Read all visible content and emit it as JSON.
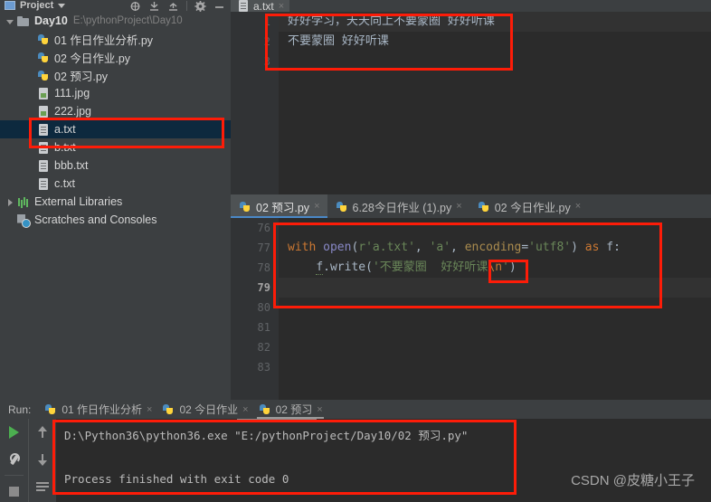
{
  "toolbar": {
    "project_label": "Project",
    "icons": [
      "locate-icon",
      "collapse-all-icon",
      "expand-all-icon",
      "settings-gear-icon",
      "minimize-icon"
    ]
  },
  "sidebar": {
    "items": [
      {
        "label": "Day10",
        "path": "E:\\pythonProject\\Day10",
        "icon": "folder-icon",
        "arrow": "down",
        "indent": 0,
        "bold": true,
        "selected": false
      },
      {
        "label": "01 作日作业分析.py",
        "path": "",
        "icon": "python-file-icon",
        "arrow": "none",
        "indent": 1,
        "bold": false,
        "selected": false
      },
      {
        "label": "02 今日作业.py",
        "path": "",
        "icon": "python-file-icon",
        "arrow": "none",
        "indent": 1,
        "bold": false,
        "selected": false
      },
      {
        "label": "02 预习.py",
        "path": "",
        "icon": "python-file-icon",
        "arrow": "none",
        "indent": 1,
        "bold": false,
        "selected": false
      },
      {
        "label": "111.jpg",
        "path": "",
        "icon": "image-file-icon",
        "arrow": "none",
        "indent": 1,
        "bold": false,
        "selected": false
      },
      {
        "label": "222.jpg",
        "path": "",
        "icon": "image-file-icon",
        "arrow": "none",
        "indent": 1,
        "bold": false,
        "selected": false
      },
      {
        "label": "a.txt",
        "path": "",
        "icon": "text-file-icon",
        "arrow": "none",
        "indent": 1,
        "bold": false,
        "selected": true
      },
      {
        "label": "b.txt",
        "path": "",
        "icon": "text-file-icon",
        "arrow": "none",
        "indent": 1,
        "bold": false,
        "selected": false
      },
      {
        "label": "bbb.txt",
        "path": "",
        "icon": "text-file-icon",
        "arrow": "none",
        "indent": 1,
        "bold": false,
        "selected": false
      },
      {
        "label": "c.txt",
        "path": "",
        "icon": "text-file-icon",
        "arrow": "none",
        "indent": 1,
        "bold": false,
        "selected": false
      },
      {
        "label": "External Libraries",
        "path": "",
        "icon": "libraries-icon",
        "arrow": "right",
        "indent": 0,
        "bold": false,
        "selected": false
      },
      {
        "label": "Scratches and Consoles",
        "path": "",
        "icon": "scratches-icon",
        "arrow": "none",
        "indent": 0,
        "bold": false,
        "selected": false
      }
    ]
  },
  "editor_top": {
    "tab": {
      "label": "a.txt",
      "icon": "text-file-icon",
      "close": "×"
    },
    "gutter": [
      "1",
      "2",
      "3"
    ],
    "lines": [
      "好好学习，天天向上不要蒙圈  好好听课",
      "不要蒙圈  好好听课",
      ""
    ]
  },
  "editor_bottom": {
    "tabs": [
      {
        "label": "02 预习.py",
        "icon": "python-file-icon",
        "close": "×",
        "active": true
      },
      {
        "label": "6.28今日作业 (1).py",
        "icon": "python-file-icon",
        "close": "×",
        "active": false
      },
      {
        "label": "02 今日作业.py",
        "icon": "python-file-icon",
        "close": "×",
        "active": false
      }
    ],
    "gutter": [
      "76",
      "77",
      "78",
      "79",
      "80",
      "81",
      "82",
      "83"
    ],
    "current_line": "79",
    "code": {
      "line77": {
        "kw_with": "with",
        "fn_open": "open",
        "paren_open": "(",
        "str_path": "r'a.txt'",
        "comma1": ", ",
        "str_mode": "'a'",
        "comma2": ", ",
        "named_arg": "encoding",
        "equals": "=",
        "str_enc": "'utf8'",
        "paren_close": ")",
        "kw_as": "as",
        "var_f": "f",
        "colon": ":"
      },
      "line78": {
        "var": "f",
        "dot_write": ".write(",
        "str": "'不要蒙圈  好好听课",
        "escape": "\\n",
        "str_end": "'",
        "close": ")"
      }
    }
  },
  "run_panel": {
    "run_label": "Run:",
    "tabs": [
      {
        "label": "01 作日作业分析",
        "icon": "python-file-icon",
        "close": "×",
        "active": false
      },
      {
        "label": "02 今日作业",
        "icon": "python-file-icon",
        "close": "×",
        "active": false
      },
      {
        "label": "02 预习",
        "icon": "python-file-icon",
        "close": "×",
        "active": true
      }
    ],
    "side_icons": [
      "run-icon",
      "rerun-wrench-icon",
      "stop-icon",
      "up-arrow-icon",
      "down-arrow-icon",
      "soft-wrap-icon"
    ],
    "console_lines": [
      "D:\\Python36\\python36.exe \"E:/pythonProject/Day10/02 预习.py\"",
      "",
      "Process finished with exit code 0"
    ]
  },
  "watermark": {
    "text": "CSDN @皮糖小王子"
  },
  "annotations": {
    "color": "#fd1c08",
    "boxes": [
      "file-a-txt-highlight",
      "txt-content-highlight",
      "code-block-highlight",
      "newline-escape-highlight",
      "console-output-highlight"
    ]
  }
}
